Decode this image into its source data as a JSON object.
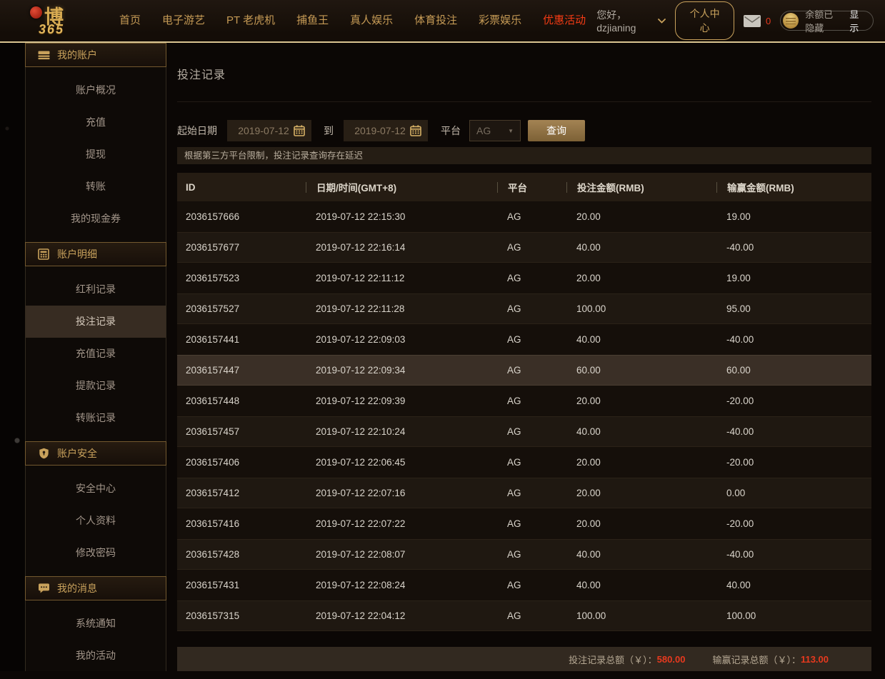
{
  "colors": {
    "accent_gold": "#c9a25c",
    "alert_red": "#e8391e",
    "header_line": "#d9c491",
    "row_highlight": "#3a2f26"
  },
  "topbar": {
    "logo": {
      "text_main": "博",
      "text_sub": "365"
    },
    "nav": [
      {
        "label": "首页"
      },
      {
        "label": "电子游艺"
      },
      {
        "label": "PT 老虎机"
      },
      {
        "label": "捕鱼王"
      },
      {
        "label": "真人娱乐"
      },
      {
        "label": "体育投注"
      },
      {
        "label": "彩票娱乐"
      },
      {
        "label": "优惠活动",
        "highlight": true
      }
    ],
    "greeting": "您好，dzjianing",
    "profile_button": "个人中心",
    "mail_count": "0",
    "balance_hidden_label": "余额已隐藏",
    "balance_show_label": "显示"
  },
  "sidebar": {
    "sections": [
      {
        "icon": "credit-card-icon",
        "label": "我的账户",
        "items": [
          {
            "label": "账户概况"
          },
          {
            "label": "充值"
          },
          {
            "label": "提现"
          },
          {
            "label": "转账"
          },
          {
            "label": "我的现金券"
          }
        ]
      },
      {
        "icon": "ledger-icon",
        "label": "账户明细",
        "items": [
          {
            "label": "红利记录"
          },
          {
            "label": "投注记录",
            "active": true
          },
          {
            "label": "充值记录"
          },
          {
            "label": "提款记录"
          },
          {
            "label": "转账记录"
          }
        ]
      },
      {
        "icon": "shield-icon",
        "label": "账户安全",
        "items": [
          {
            "label": "安全中心"
          },
          {
            "label": "个人资料"
          },
          {
            "label": "修改密码"
          }
        ]
      },
      {
        "icon": "message-icon",
        "label": "我的消息",
        "items": [
          {
            "label": "系统通知"
          },
          {
            "label": "我的活动"
          }
        ]
      }
    ]
  },
  "main": {
    "page_title": "投注记录",
    "filters": {
      "start_label": "起始日期",
      "start_date": "2019-07-12",
      "to_label": "到",
      "end_date": "2019-07-12",
      "platform_label": "平台",
      "platform_value": "AG",
      "search_button": "查询"
    },
    "notice": "根据第三方平台限制，投注记录查询存在延迟",
    "table": {
      "columns": [
        "ID",
        "日期/时间(GMT+8)",
        "平台",
        "投注金额(RMB)",
        "输赢金额(RMB)"
      ],
      "rows": [
        [
          "2036157666",
          "2019-07-12 22:15:30",
          "AG",
          "20.00",
          "19.00"
        ],
        [
          "2036157677",
          "2019-07-12 22:16:14",
          "AG",
          "40.00",
          "-40.00"
        ],
        [
          "2036157523",
          "2019-07-12 22:11:12",
          "AG",
          "20.00",
          "19.00"
        ],
        [
          "2036157527",
          "2019-07-12 22:11:28",
          "AG",
          "100.00",
          "95.00"
        ],
        [
          "2036157441",
          "2019-07-12 22:09:03",
          "AG",
          "40.00",
          "-40.00"
        ],
        [
          "2036157447",
          "2019-07-12 22:09:34",
          "AG",
          "60.00",
          "60.00"
        ],
        [
          "2036157448",
          "2019-07-12 22:09:39",
          "AG",
          "20.00",
          "-20.00"
        ],
        [
          "2036157457",
          "2019-07-12 22:10:24",
          "AG",
          "40.00",
          "-40.00"
        ],
        [
          "2036157406",
          "2019-07-12 22:06:45",
          "AG",
          "20.00",
          "-20.00"
        ],
        [
          "2036157412",
          "2019-07-12 22:07:16",
          "AG",
          "20.00",
          "0.00"
        ],
        [
          "2036157416",
          "2019-07-12 22:07:22",
          "AG",
          "20.00",
          "-20.00"
        ],
        [
          "2036157428",
          "2019-07-12 22:08:07",
          "AG",
          "40.00",
          "-40.00"
        ],
        [
          "2036157431",
          "2019-07-12 22:08:24",
          "AG",
          "40.00",
          "40.00"
        ],
        [
          "2036157315",
          "2019-07-12 22:04:12",
          "AG",
          "100.00",
          "100.00"
        ]
      ],
      "highlighted_row_index": 5
    },
    "totals": {
      "bet_label": "投注记录总额（￥）：",
      "bet_value": "580.00",
      "win_label": "输赢记录总额（￥）：",
      "win_value": "113.00"
    }
  }
}
